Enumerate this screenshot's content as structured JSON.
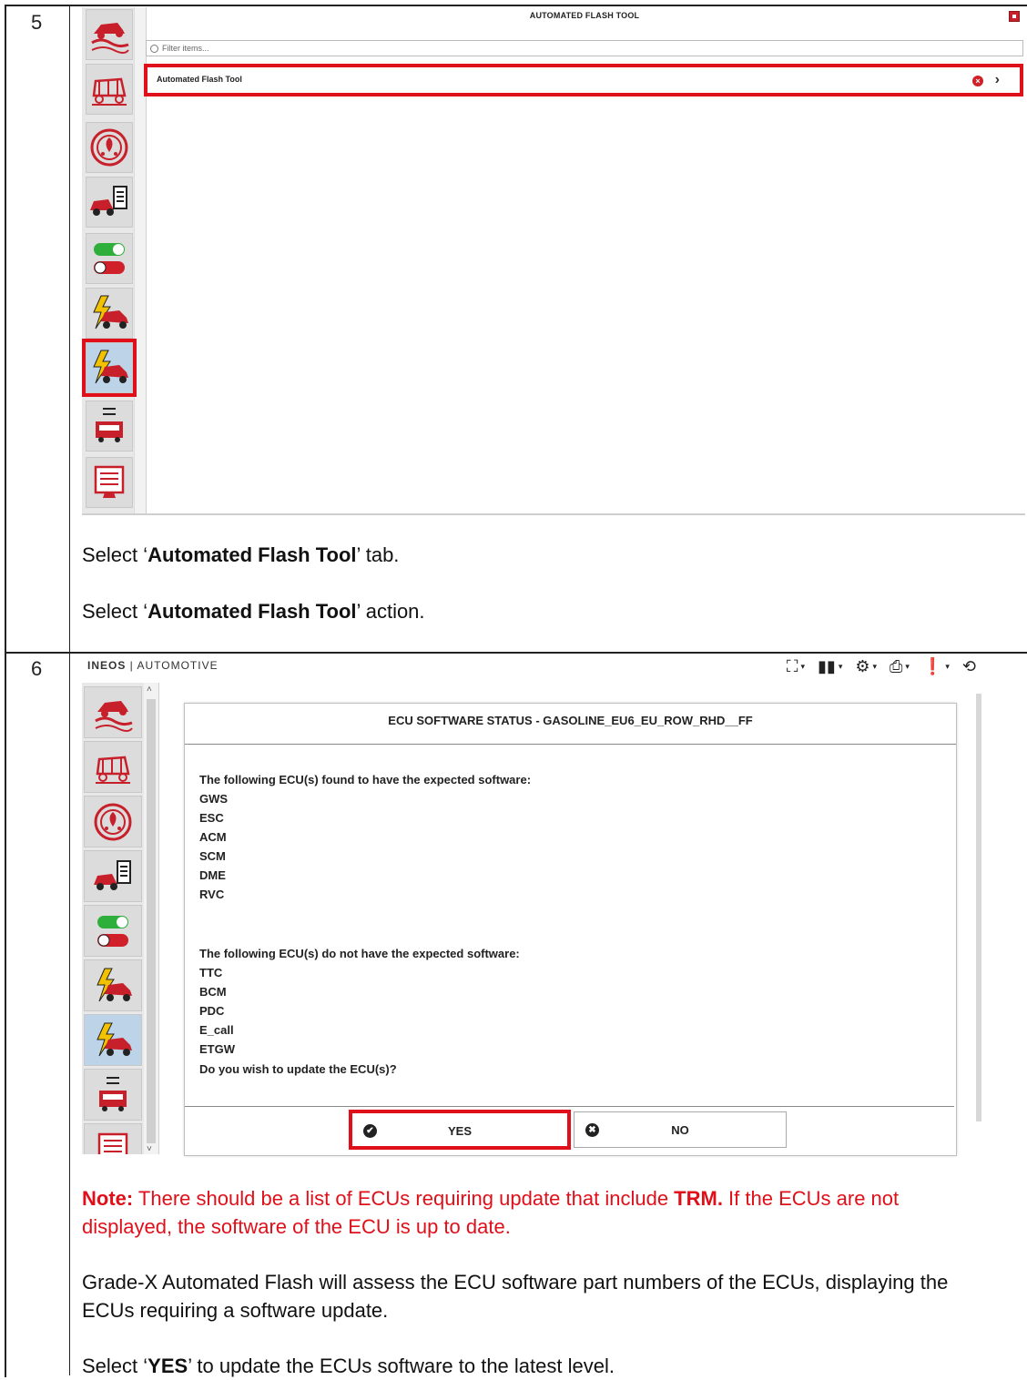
{
  "steps": [
    {
      "number": "5"
    },
    {
      "number": "6"
    }
  ],
  "step5": {
    "app_title": "AUTOMATED FLASH TOOL",
    "filter_placeholder": "Filter items...",
    "list_item": "Automated Flash Tool",
    "instruction_1_pre": "Select ‘",
    "instruction_1_bold": "Automated Flash Tool",
    "instruction_1_post": "’ tab.",
    "instruction_2_pre": "Select ‘",
    "instruction_2_bold": "Automated Flash Tool",
    "instruction_2_post": "’ action."
  },
  "sidebar_icons": [
    "off-road-vehicle-icon",
    "vehicle-diagram-icon",
    "diagnostic-dial-icon",
    "vehicle-report-icon",
    "toggle-switches-icon",
    "flash-vehicle-icon",
    "automated-flash-icon",
    "binary-vehicle-icon",
    "document-monitor-icon"
  ],
  "step6": {
    "brand_left": "INEOS",
    "brand_right": "AUTOMOTIVE",
    "toolbar_icons": [
      "network-icon",
      "battery-icon",
      "settings-gear-icon",
      "printer-icon",
      "feedback-icon",
      "exit-icon"
    ],
    "dialog_title": "ECU SOFTWARE STATUS - GASOLINE_EU6_EU_ROW_RHD__FF",
    "expected_heading": "The following ECU(s) found to have the expected software:",
    "expected_list": [
      "GWS",
      "ESC",
      "ACM",
      "SCM",
      "DME",
      "RVC"
    ],
    "not_expected_heading": "The following ECU(s) do not have the expected software:",
    "not_expected_list": [
      "TTC",
      "BCM",
      "PDC",
      "E_call",
      "ETGW"
    ],
    "question": "Do you wish to update the ECU(s)?",
    "yes_label": "YES",
    "no_label": "NO",
    "note_label": "Note:",
    "note_pre": " There should be a list of ECUs requiring update that include ",
    "note_bold": "TRM.",
    "note_post_line1": " If the ECUs are not",
    "note_line2": "displayed, the software of the ECU is up to date.",
    "para_line1": "Grade-X Automated Flash will assess the ECU software part numbers of the ECUs, displaying the",
    "para_line2": "ECUs requiring a software update.",
    "select_pre": "Select ‘",
    "select_bold": "YES",
    "select_post": "’ to update the ECUs software to the latest level."
  },
  "colors": {
    "highlight": "#e0101a",
    "note_text": "#e0101a"
  }
}
